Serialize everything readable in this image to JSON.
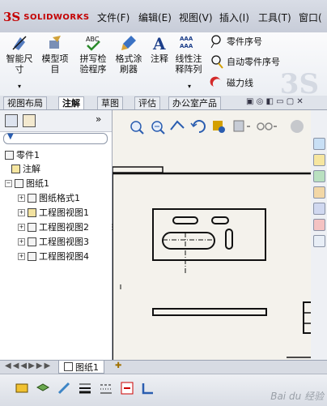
{
  "app": {
    "logo_mark": "3S",
    "logo_text": "SOLIDWORKS"
  },
  "menu": [
    "文件(F)",
    "编辑(E)",
    "视图(V)",
    "插入(I)",
    "工具(T)",
    "窗口("
  ],
  "ribbon": {
    "big": [
      {
        "label": "智能尺\n寸",
        "icon": "smart-dimension-icon"
      },
      {
        "label": "模型项\n目",
        "icon": "model-items-icon"
      },
      {
        "label": "拼写检\n验程序",
        "icon": "spell-check-icon"
      },
      {
        "label": "格式涂\n刷器",
        "icon": "format-painter-icon"
      },
      {
        "label": "注释",
        "icon": "note-icon"
      },
      {
        "label": "线性注\n释阵列",
        "icon": "linear-pattern-icon"
      }
    ],
    "small": [
      {
        "label": "零件序号",
        "icon": "balloon-icon"
      },
      {
        "label": "自动零件序号",
        "icon": "auto-balloon-icon"
      },
      {
        "label": "磁力线",
        "icon": "magnetic-line-icon"
      }
    ],
    "ghost": "3S"
  },
  "tabs": [
    "视图布局",
    "注解",
    "草图",
    "评估",
    "办公室产品"
  ],
  "active_tab": 1,
  "tree": {
    "root": "零件1",
    "items": [
      {
        "label": "注解",
        "indent": 1,
        "expand": false
      },
      {
        "label": "图纸1",
        "indent": 1,
        "expand": true
      },
      {
        "label": "图纸格式1",
        "indent": 2,
        "expand": true
      },
      {
        "label": "工程图视图1",
        "indent": 2,
        "expand": true
      },
      {
        "label": "工程图视图2",
        "indent": 2,
        "expand": true
      },
      {
        "label": "工程图视图3",
        "indent": 2,
        "expand": true
      },
      {
        "label": "工程图视图4",
        "indent": 2,
        "expand": true
      }
    ]
  },
  "sheet_tabs": {
    "sheet": "图纸1"
  },
  "watermark": "Bai du 经验",
  "colors": {
    "brand": "#c40000",
    "accent_blue": "#2a5db0"
  }
}
